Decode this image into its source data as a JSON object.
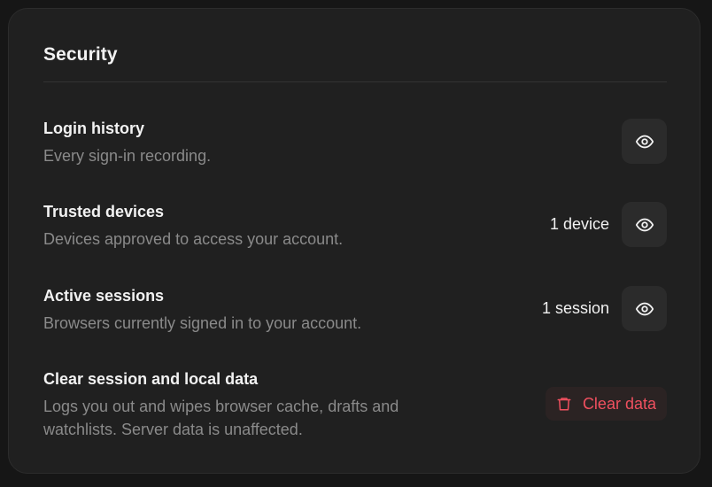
{
  "section": {
    "title": "Security"
  },
  "rows": [
    {
      "title": "Login history",
      "description": "Every sign-in recording.",
      "action_icon": "eye-icon"
    },
    {
      "title": "Trusted devices",
      "description": "Devices approved to access your account.",
      "count": "1 device",
      "action_icon": "eye-icon"
    },
    {
      "title": "Active sessions",
      "description": "Browsers currently signed in to your account.",
      "count": "1 session",
      "action_icon": "eye-icon"
    },
    {
      "title": "Clear session and local data",
      "description": "Logs you out and wipes browser cache, drafts and watchlists. Server data is unaffected.",
      "button_label": "Clear data",
      "button_icon": "trash-icon"
    }
  ],
  "colors": {
    "background": "#161616",
    "card": "#202020",
    "danger": "#f0505f",
    "muted_text": "#8a8a8a"
  }
}
